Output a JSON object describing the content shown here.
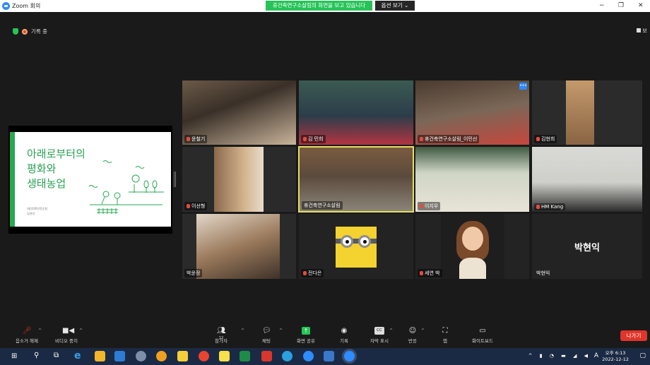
{
  "window": {
    "title": "Zoom 회의",
    "share_banner": "휴건축연구소살림의 화면을 보고 있습니다",
    "view_option": "옵션 보기"
  },
  "recording": {
    "label": "기록 중"
  },
  "view_button": {
    "label": "보"
  },
  "slide": {
    "line1": "아래로부터의",
    "line2": "평화와",
    "line3": "생태농업",
    "sub1": "(재)100년후순창",
    "sub2": "김현미"
  },
  "participants": [
    {
      "name": "윤철기",
      "muted": true
    },
    {
      "name": "김 민희",
      "muted": true
    },
    {
      "name": "휴건축연구소살림_이민선",
      "muted": true
    },
    {
      "name": "김현희",
      "muted": true
    },
    {
      "name": "이선형",
      "muted": true
    },
    {
      "name": "휴건축연구소살림",
      "muted": false
    },
    {
      "name": "이지우",
      "muted": true
    },
    {
      "name": "HM Kang",
      "muted": true
    },
    {
      "name": "박윤정",
      "muted": false
    },
    {
      "name": "전다은",
      "muted": true
    },
    {
      "name": "세연 박",
      "muted": true
    },
    {
      "name": "박현익",
      "muted": false,
      "display": "박현익"
    }
  ],
  "toolbar": {
    "unmute": "음소거 해제",
    "stop_video": "비디오 중지",
    "participants": "참가자",
    "participant_count": "12",
    "chat": "채팅",
    "share": "화면 공유",
    "record": "기록",
    "captions": "자막 표시",
    "reactions": "반응",
    "apps": "앱",
    "whiteboard": "화이트보드",
    "leave": "나가기",
    "cc": "CC"
  },
  "taskbar": {
    "time": "오후 6:13",
    "date": "2022-12-12",
    "lang": "A"
  },
  "colors": {
    "share_green": "#26c458",
    "accent_blue": "#2d8cff",
    "leave_red": "#e0352a",
    "slide_green": "#27a851",
    "active_speaker": "#e4e061"
  }
}
